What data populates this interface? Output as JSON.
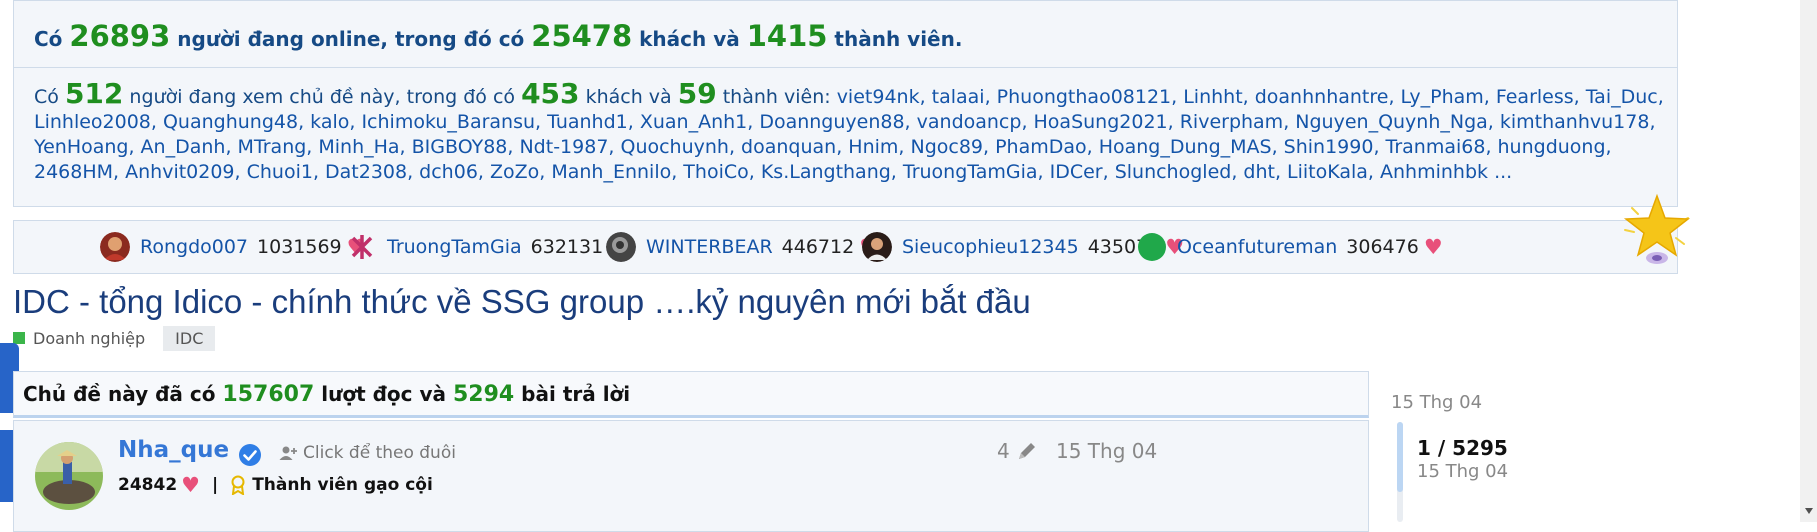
{
  "online": {
    "p1": "Có ",
    "total": "26893",
    "p2": " người đang online, trong đó có ",
    "guests": "25478",
    "p3": " khách và ",
    "members": "1415",
    "p4": " thành viên."
  },
  "viewers": {
    "p1": "Có ",
    "total": "512",
    "p2": " người đang xem chủ đề này, trong đó có ",
    "guests": "453",
    "p3": " khách và ",
    "members_count": "59",
    "p4": " thành viên: ",
    "members_list": "viet94nk, talaai, Phuongthao08121, Linhht, doanhnhantre, Ly_Pham, Fearless, Tai_Duc, Linhleo2008, Quanghung48, kalo, Ichimoku_Baransu, Tuanhd1, Xuan_Anh1, Doannguyen88, vandoancp, HoaSung2021, Riverpham, Nguyen_Quynh_Nga, kimthanhvu178, YenHoang, An_Danh, MTrang, Minh_Ha, BIGBOY88, Ndt-1987, Quochuynh, doanquan, Hnim, Ngoc89, PhamDao, Hoang_Dung_MAS, Shin1990, Tranmai68, hungduong, 2468HM, Anhvit0209, Chuoi1, Dat2308, dch06, ZoZo, Manh_Ennilo, ThoiCo, Ks.Langthang, TruongTamGia, IDCer, Slunchogled, dht, LiitoKala, Anhminhbk ..."
  },
  "top_users": [
    {
      "name": "Rongdo007",
      "score": "1031569",
      "avatar_color": "#8b2a1f"
    },
    {
      "name": "TruongTamGia",
      "score": "632131",
      "avatar_color": "#c0306a"
    },
    {
      "name": "WINTERBEAR",
      "score": "446712",
      "avatar_color": "#333333"
    },
    {
      "name": "Sieucophieu12345",
      "score": "435075",
      "avatar_color": "#2a1c18"
    },
    {
      "name": "Oceanfutureman",
      "score": "306476",
      "avatar_color": "#20a84a"
    }
  ],
  "heart_glyph": "♥",
  "thread": {
    "title": "IDC - tổng Idico - chính thức về SSG group ….kỷ nguyên mới bắt đầu",
    "category": "Doanh nghiệp",
    "tag": "IDC"
  },
  "stats": {
    "p1": "Chủ đề này đã có ",
    "views": "157607",
    "p2": " lượt đọc và ",
    "replies": "5294",
    "p3": " bài trả lời"
  },
  "post": {
    "author": "Nha_que",
    "follow_label": "Click để theo đuôi",
    "score": "24842",
    "separator": "|",
    "rank": "Thành viên gạo cội",
    "edit_count": "4",
    "date": "15 Thg 04"
  },
  "sidebar": {
    "date_top": "15 Thg 04",
    "position": "1 / 5295",
    "date_bottom": "15 Thg 04"
  },
  "colors": {
    "accent_green": "#1f8e1f",
    "link_blue": "#1454a8",
    "heart": "#e8507a",
    "brand_blue": "#2764c8"
  }
}
